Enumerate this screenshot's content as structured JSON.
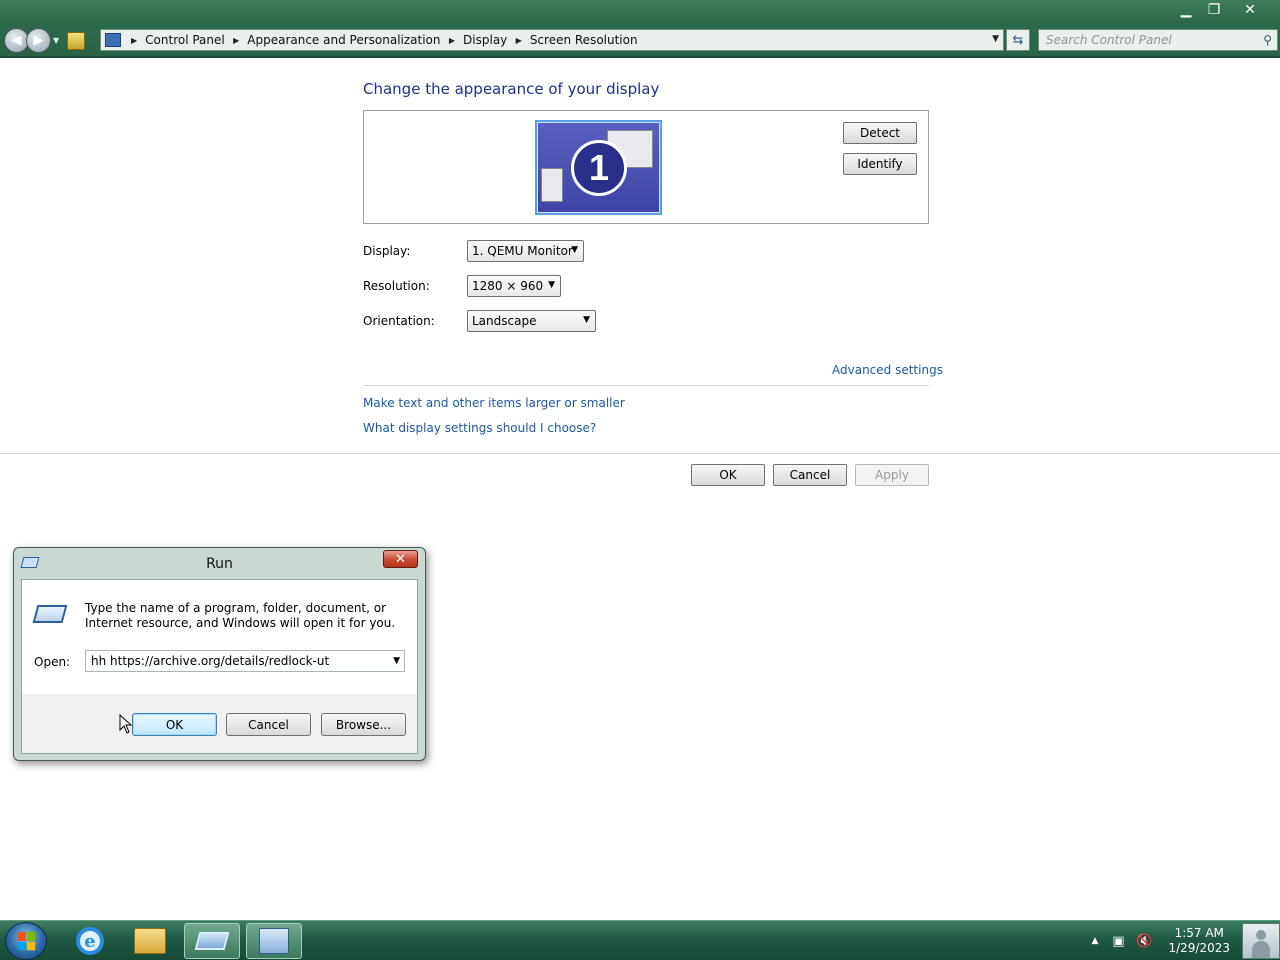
{
  "window": {
    "controls": {
      "minimize": "▁",
      "restore": "❐",
      "close": "✕"
    }
  },
  "address_bar": {
    "crumbs": [
      "Control Panel",
      "Appearance and Personalization",
      "Display",
      "Screen Resolution"
    ],
    "search_placeholder": "Search Control Panel"
  },
  "main": {
    "heading": "Change the appearance of your display",
    "monitor_number": "1",
    "detect_label": "Detect",
    "identify_label": "Identify",
    "display_label": "Display:",
    "display_value": "1. QEMU Monitor",
    "resolution_label": "Resolution:",
    "resolution_value": "1280 × 960",
    "orientation_label": "Orientation:",
    "orientation_value": "Landscape",
    "advanced_link": "Advanced settings",
    "link_text_size": "Make text and other items larger or smaller",
    "link_which_settings": "What display settings should I choose?",
    "ok_label": "OK",
    "cancel_label": "Cancel",
    "apply_label": "Apply"
  },
  "run_dialog": {
    "title": "Run",
    "description": "Type the name of a program, folder, document, or Internet resource, and Windows will open it for you.",
    "open_label": "Open:",
    "open_value": "hh https://archive.org/details/redlock-ut",
    "ok_label": "OK",
    "cancel_label": "Cancel",
    "browse_label": "Browse..."
  },
  "taskbar": {
    "clock_time": "1:57 AM",
    "clock_date": "1/29/2023",
    "icons": [
      "start-orb",
      "internet-explorer-icon",
      "file-explorer-icon",
      "run-icon",
      "control-panel-icon"
    ]
  },
  "colors": {
    "accent_heading": "#1e3287",
    "link": "#1e59a3",
    "chrome_green": "#2c6a4b"
  }
}
